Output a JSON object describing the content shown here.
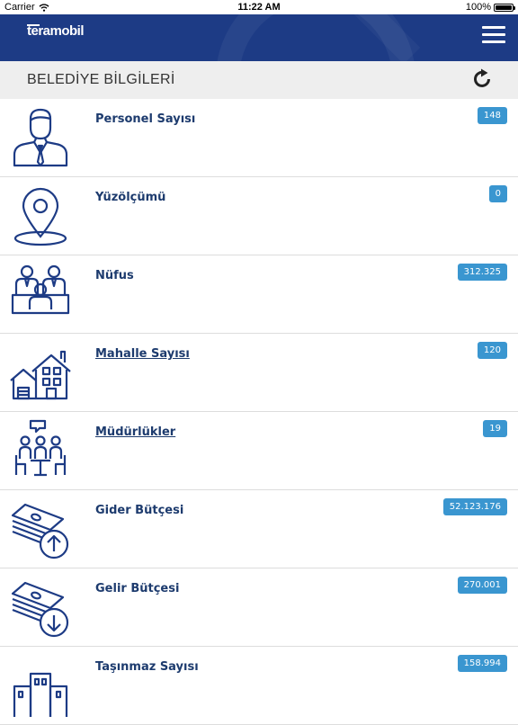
{
  "status_bar": {
    "carrier": "Carrier",
    "time": "11:22 AM",
    "battery": "100%",
    "battery_level": 1.0
  },
  "app": {
    "logo_text": "teramobil",
    "title": "BELEDİYE BİLGİLERİ",
    "nav_color": "#1d3b85",
    "badge_color": "#3a96d0"
  },
  "items": [
    {
      "label": "Personel Sayısı",
      "value": "148",
      "icon": "employee-icon"
    },
    {
      "label": "Yüzölçümü",
      "value": "0",
      "icon": "map-pin-icon"
    },
    {
      "label": "Nüfus",
      "value": "312.325",
      "icon": "population-icon"
    },
    {
      "label": "Mahalle Sayısı",
      "value": "120",
      "icon": "houses-icon"
    },
    {
      "label": "Müdürlükler",
      "value": "19",
      "icon": "meeting-icon"
    },
    {
      "label": "Gider Bütçesi",
      "value": "52.123.176",
      "icon": "money-up-icon"
    },
    {
      "label": "Gelir Bütçesi",
      "value": "270.001",
      "icon": "money-down-icon"
    },
    {
      "label": "Taşınmaz Sayısı",
      "value": "158.994",
      "icon": "building-icon"
    }
  ]
}
